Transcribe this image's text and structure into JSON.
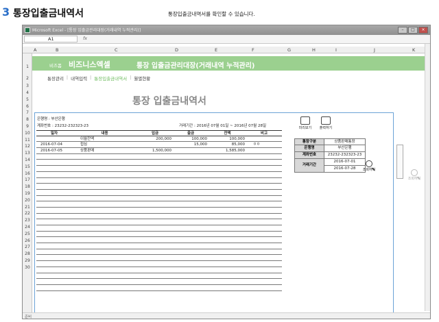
{
  "header": {
    "number": "3",
    "title": "통장입출금내역서",
    "description": "통장입출금내역서를 확인할 수 있습니다."
  },
  "excel": {
    "window_title": "Microsoft Excel - [통장 입출금관리대장(거래내역 누적관리)]",
    "name_box": "A1",
    "fx": "fx",
    "columns": [
      "A",
      "B",
      "C",
      "D",
      "E",
      "F",
      "G",
      "H",
      "I",
      "J",
      "K"
    ],
    "rows": [
      "1",
      "2",
      "3",
      "4",
      "5",
      "6",
      "7",
      "8",
      "9",
      "10",
      "11",
      "12",
      "13",
      "14",
      "15",
      "16",
      "17",
      "18",
      "19",
      "20",
      "21",
      "22",
      "23",
      "24",
      "25",
      "26",
      "27",
      "28",
      "29",
      "30"
    ],
    "status": "준비"
  },
  "banner": {
    "small": "비즈폼",
    "brand": "비즈니스엑셀",
    "title": "통장 입출금관리대장(거래내역 누적관리)"
  },
  "menu": {
    "items": [
      "통장관리",
      "내역입력",
      "통장입출금내역서",
      "월별현황"
    ],
    "active": "통장입출금내역서"
  },
  "sheet": {
    "title": "통장 입출금내역서"
  },
  "document": {
    "bank_line": "은행명 : 부산은행",
    "account_line": "계좌번호 : 23232-232323-23",
    "period_line": "거래기간 : 2016년 07월 01일 ~ 2016년 07월 28일",
    "headers": [
      "일자",
      "내용",
      "입금",
      "출금",
      "잔액",
      "비고"
    ],
    "rows": [
      {
        "date": "",
        "content": "이월잔액",
        "deposit": "200,000",
        "withdraw": "100,000",
        "balance": "100,000",
        "note": ""
      },
      {
        "date": "2016-07-04",
        "content": "접심",
        "deposit": "",
        "withdraw": "15,000",
        "balance": "85,000",
        "note": "ㅇㅇ"
      },
      {
        "date": "2016-07-05",
        "content": "상품판매",
        "deposit": "1,500,000",
        "withdraw": "",
        "balance": "1,585,000",
        "note": ""
      }
    ],
    "empty_rows": 23
  },
  "buttons": {
    "preview": "미리보기",
    "print": "출력하기",
    "lookup": "조회하기"
  },
  "info": {
    "type_label": "통장구분",
    "type_value": "상품판매통장",
    "bank_label": "은행명",
    "bank_value": "부산은행",
    "account_label": "계좌번호",
    "account_value": "23232-232323-23",
    "period_label": "거래기간",
    "period_start": "2016-07-01",
    "period_end": "2016-07-28"
  }
}
